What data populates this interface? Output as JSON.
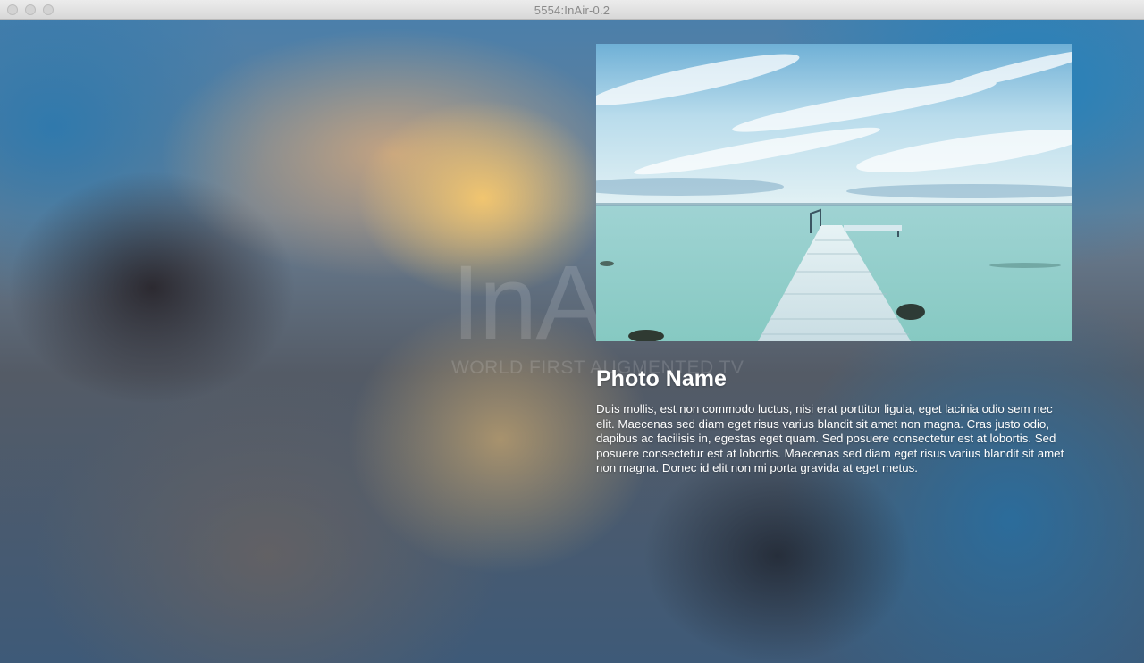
{
  "window": {
    "title": "5554:InAir-0.2"
  },
  "watermark": {
    "logo": "InAir",
    "tagline": "WORLD FIRST AUGMENTED TV"
  },
  "photo": {
    "name": "Photo Name",
    "description": "Duis mollis, est non commodo luctus, nisi erat porttitor ligula, eget lacinia odio sem nec elit. Maecenas sed diam eget risus varius blandit sit amet non magna. Cras justo odio, dapibus ac facilisis in, egestas eget quam. Sed posuere consectetur est at lobortis. Sed posuere consectetur est at lobortis. Maecenas sed diam eget risus varius blandit sit amet non magna. Donec id elit non mi porta gravida at eget metus."
  },
  "colors": {
    "text": "#ffffff",
    "titlebar": "#e3e3e3"
  }
}
